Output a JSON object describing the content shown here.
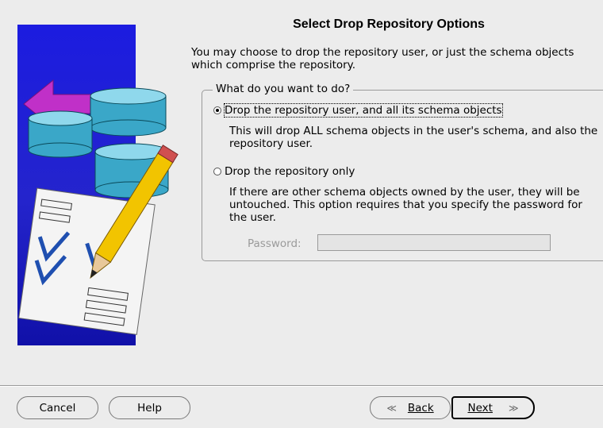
{
  "title": "Select Drop Repository Options",
  "intro": "You may choose to drop the repository user, or just the schema objects which comprise the repository.",
  "group": {
    "legend": "What do you want to do?",
    "options": [
      {
        "label": "Drop the repository user, and all its schema objects",
        "checked": true,
        "description": "This will drop ALL schema objects in the user's schema, and also the repository user."
      },
      {
        "label": "Drop the repository only",
        "checked": false,
        "description": "If there are other schema objects owned by the user, they will be untouched. This option requires that you specify the password for the user."
      }
    ],
    "password_label": "Password:",
    "password_value": ""
  },
  "buttons": {
    "cancel": "Cancel",
    "help": "Help",
    "back": "Back",
    "next": "Next"
  },
  "icons": {
    "back_arrow": "≪",
    "next_arrow": "≫",
    "artwork": "database-checklist-pencil-icon"
  },
  "colors": {
    "background": "#ececec",
    "art_panel": "#2020d0"
  }
}
